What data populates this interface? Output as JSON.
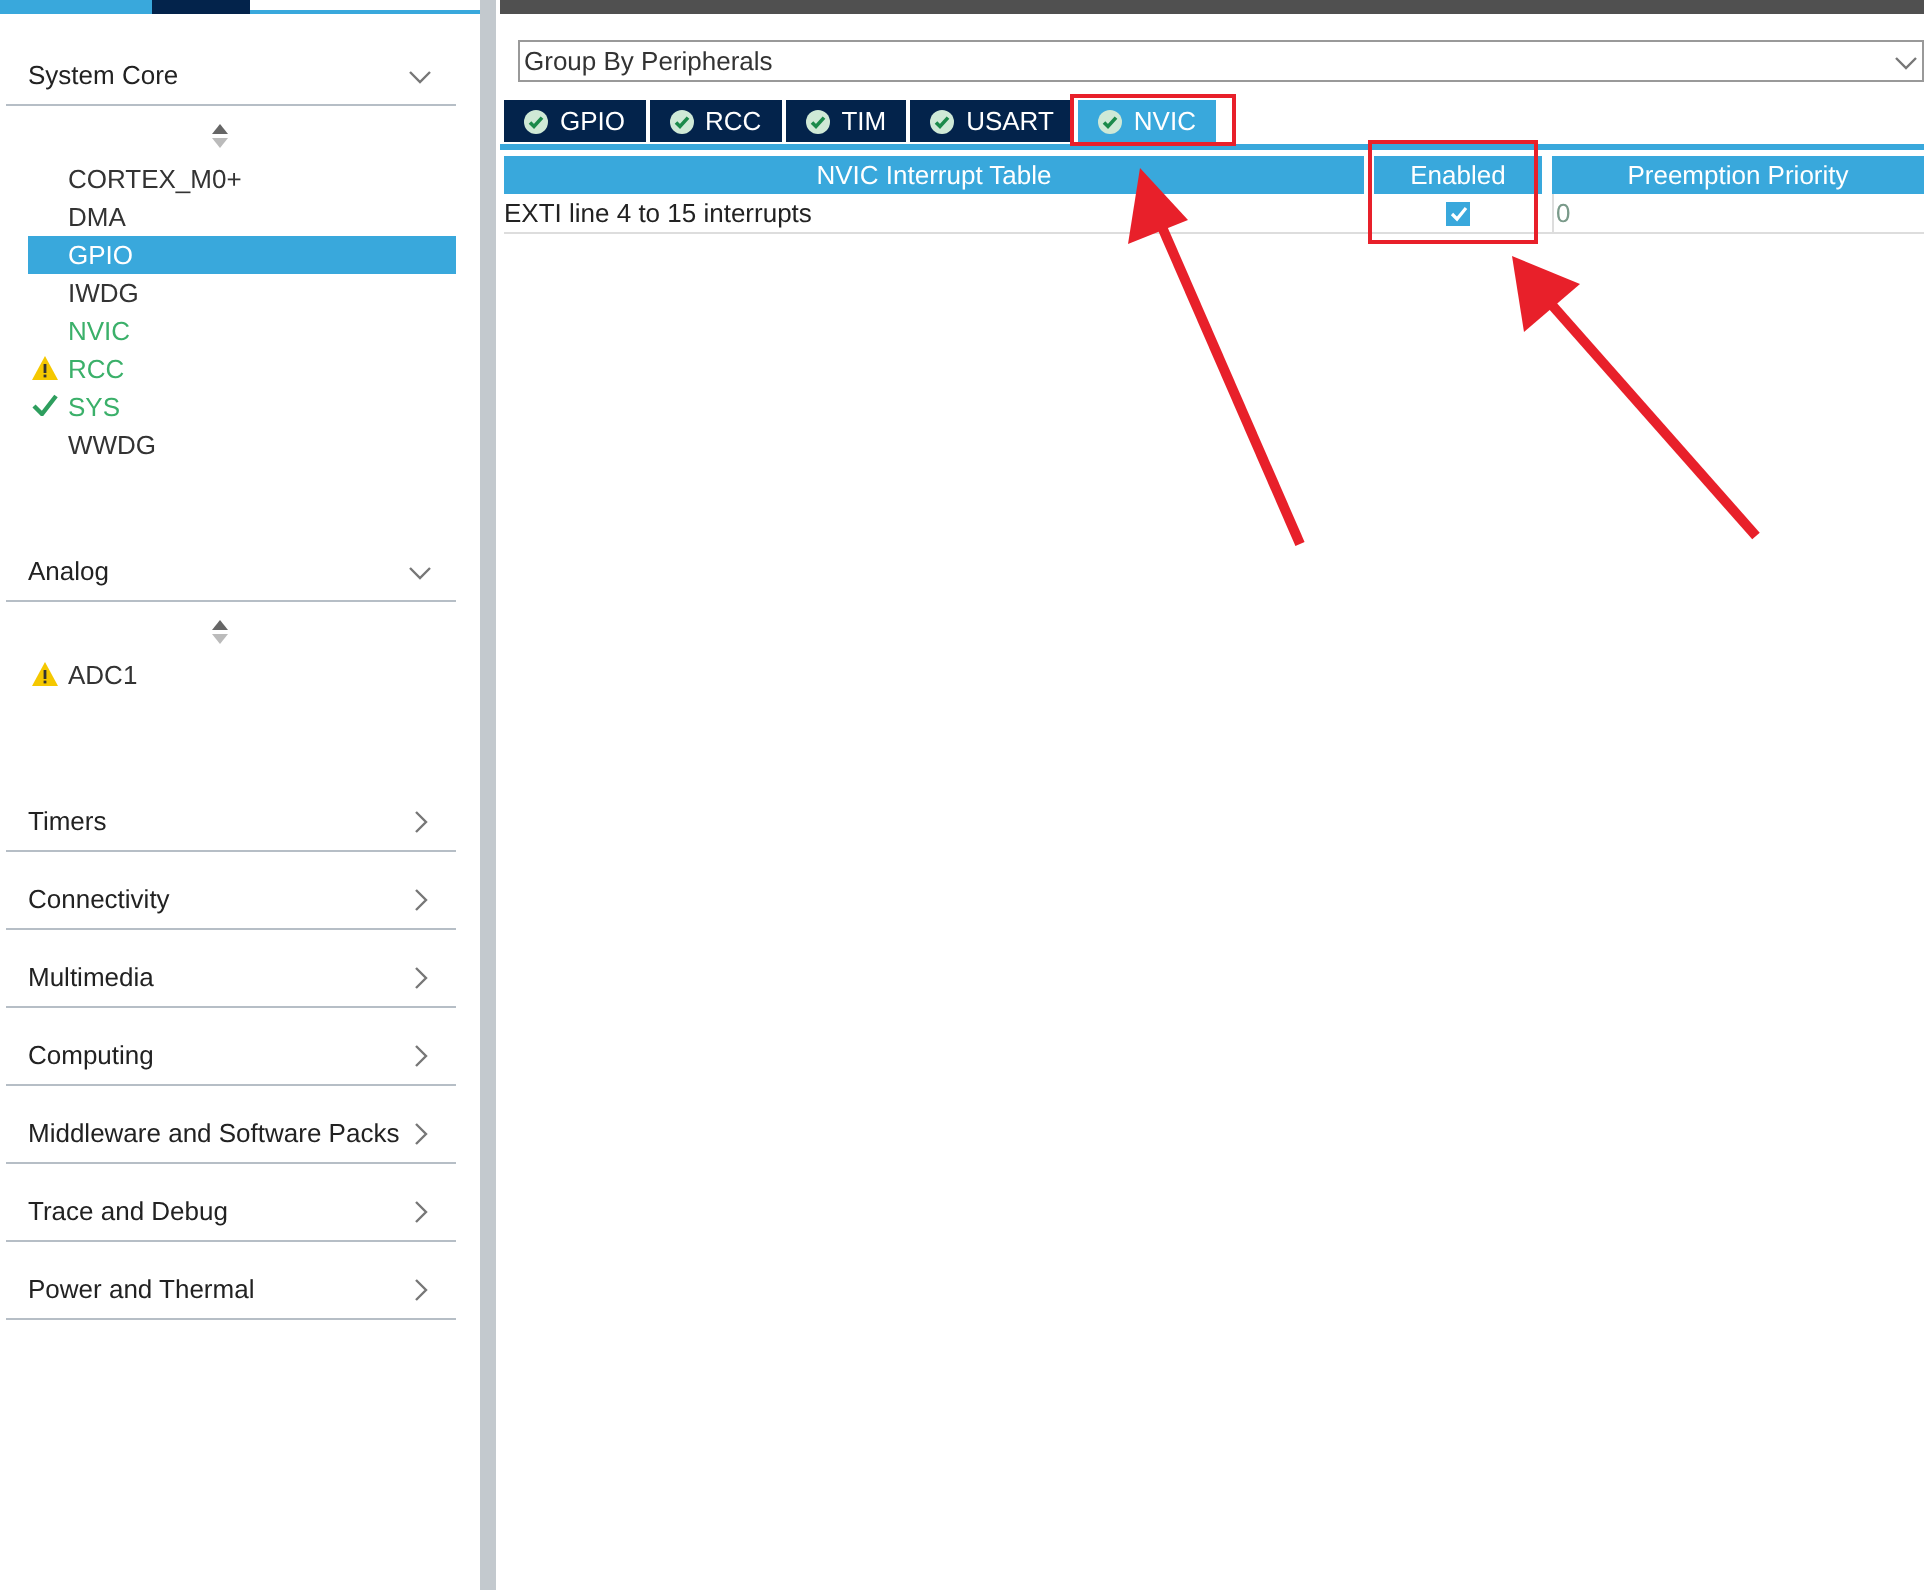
{
  "sidebar": {
    "sections": [
      {
        "title": "System Core",
        "expanded": true,
        "items": [
          {
            "label": "CORTEX_M0+",
            "selected": false,
            "configured": false,
            "kind": "plain"
          },
          {
            "label": "DMA",
            "selected": false,
            "configured": false,
            "kind": "plain"
          },
          {
            "label": "GPIO",
            "selected": true,
            "configured": false,
            "kind": "plain"
          },
          {
            "label": "IWDG",
            "selected": false,
            "configured": false,
            "kind": "plain"
          },
          {
            "label": "NVIC",
            "selected": false,
            "configured": true,
            "kind": "plain"
          },
          {
            "label": "RCC",
            "selected": false,
            "configured": true,
            "kind": "warning"
          },
          {
            "label": "SYS",
            "selected": false,
            "configured": true,
            "kind": "ok"
          },
          {
            "label": "WWDG",
            "selected": false,
            "configured": false,
            "kind": "plain"
          }
        ]
      },
      {
        "title": "Analog",
        "expanded": true,
        "items": [
          {
            "label": "ADC1",
            "selected": false,
            "configured": false,
            "kind": "warning"
          }
        ]
      },
      {
        "title": "Timers",
        "expanded": false
      },
      {
        "title": "Connectivity",
        "expanded": false
      },
      {
        "title": "Multimedia",
        "expanded": false
      },
      {
        "title": "Computing",
        "expanded": false
      },
      {
        "title": "Middleware and Software Packs",
        "expanded": false
      },
      {
        "title": "Trace and Debug",
        "expanded": false
      },
      {
        "title": "Power and Thermal",
        "expanded": false
      }
    ]
  },
  "group_by": {
    "value": "Group By Peripherals"
  },
  "tabs": [
    {
      "label": "GPIO",
      "selected": false
    },
    {
      "label": "RCC",
      "selected": false
    },
    {
      "label": "TIM",
      "selected": false
    },
    {
      "label": "USART",
      "selected": false
    },
    {
      "label": "NVIC",
      "selected": true
    }
  ],
  "table": {
    "columns": [
      "NVIC Interrupt Table",
      "Enabled",
      "Preemption Priority"
    ],
    "rows": [
      {
        "name": "EXTI line 4 to 15 interrupts",
        "enabled": true,
        "priority": "0"
      }
    ]
  }
}
